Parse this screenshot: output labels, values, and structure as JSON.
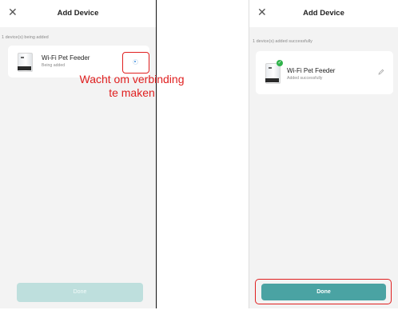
{
  "left_screen": {
    "title": "Add Device",
    "close_glyph": "✕",
    "status": "1 device(s) being added",
    "device": {
      "name": "Wi-Fi Pet Feeder",
      "status": "Being added"
    },
    "done_label": "Done"
  },
  "right_screen": {
    "title": "Add Device",
    "close_glyph": "✕",
    "status": "1 device(s) added successfully",
    "device": {
      "name": "Wi-Fi Pet Feeder",
      "status": "Added successfully"
    },
    "done_label": "Done"
  },
  "annotation": {
    "line1": "Wacht om verbinding",
    "line2": "te maken"
  },
  "colors": {
    "annotation_red": "#e02020",
    "done_disabled": "#bedfdd",
    "done_active": "#4aa3a3",
    "success_green": "#2fb34a"
  },
  "icons": [
    "close-icon",
    "loading-spinner-icon",
    "check-badge-icon",
    "edit-pencil-icon"
  ]
}
